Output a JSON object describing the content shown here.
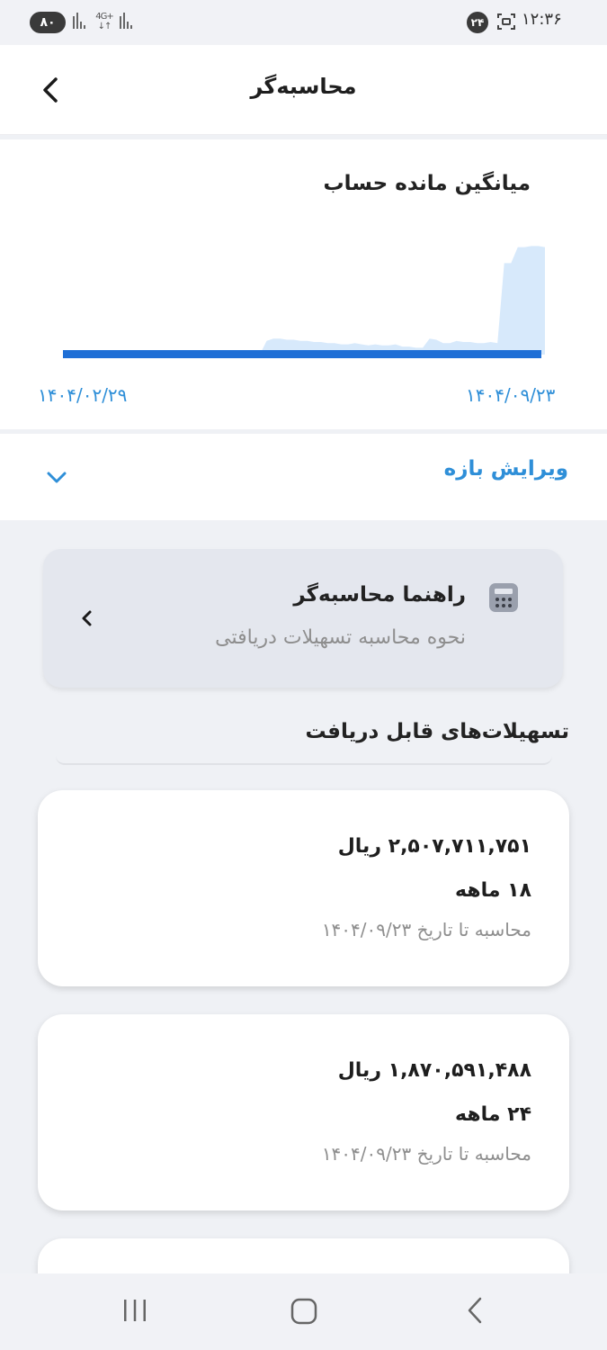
{
  "status_bar": {
    "battery": "۸۰",
    "network": "4G+",
    "notification_count": "۲۴",
    "time": "۱۲:۳۶"
  },
  "app_bar": {
    "title": "محاسبه‌گر",
    "back_icon": "chevron-left-icon"
  },
  "chart": {
    "title": "میانگین مانده حساب",
    "start_date": "۱۴۰۴/۰۲/۲۹",
    "end_date": "۱۴۰۴/۰۹/۲۳"
  },
  "chart_data": {
    "type": "area",
    "title": "میانگین مانده حساب",
    "x_start_label": "۱۴۰۴/۰۲/۲۹",
    "x_end_label": "۱۴۰۴/۰۹/۲۳",
    "series": [
      {
        "values": [
          0,
          0,
          0,
          0,
          0,
          0,
          0,
          0,
          0,
          0,
          0,
          0,
          0,
          0,
          0,
          0,
          0,
          0,
          0,
          0,
          0,
          0,
          0,
          0,
          0,
          0,
          0,
          0,
          0,
          0,
          12,
          14,
          14,
          13,
          13,
          12,
          12,
          11,
          11,
          10,
          10,
          9,
          9,
          10,
          9,
          8,
          9,
          8,
          8,
          9,
          7,
          7,
          6,
          6,
          14,
          13,
          10,
          10,
          12,
          11,
          11,
          10,
          10,
          11,
          10,
          80,
          80,
          94,
          94,
          95,
          95,
          94
        ]
      }
    ],
    "baseline_color": "#1f6fd6",
    "fill_color": "#d7e9fb",
    "grid": false
  },
  "edit_range": {
    "label": "ویرایش بازه",
    "icon": "chevron-down-icon"
  },
  "guide": {
    "title": "راهنما محاسبه‌گر",
    "subtitle": "نحوه محاسبه تسهیلات دریافتی",
    "icon": "calculator-icon",
    "chevron": "chevron-left-icon"
  },
  "section": {
    "title": "تسهیلات‌های قابل دریافت"
  },
  "loans": [
    {
      "amount": "۲,۵۰۷,۷۱۱,۷۵۱ ریال",
      "term": "۱۸ ماهه",
      "date_note": "محاسبه تا تاریخ ۱۴۰۴/۰۹/۲۳"
    },
    {
      "amount": "۱,۸۷۰,۵۹۱,۴۸۸ ریال",
      "term": "۲۴ ماهه",
      "date_note": "محاسبه تا تاریخ ۱۴۰۴/۰۹/۲۳"
    }
  ],
  "nav_bar": {
    "recents_icon": "recents-icon",
    "home_icon": "home-icon",
    "back_icon": "back-icon"
  },
  "colors": {
    "accent": "#2f8fd8",
    "chart_line": "#1f6fd6",
    "chart_fill": "#d7e9fb",
    "background": "#eff1f5"
  }
}
